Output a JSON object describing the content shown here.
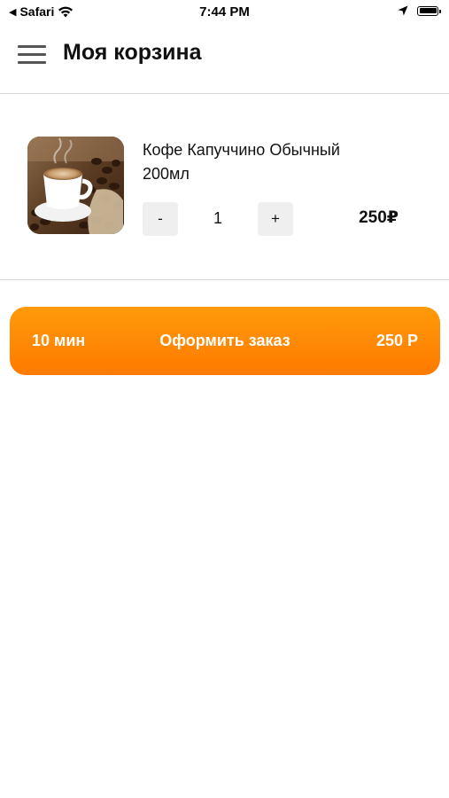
{
  "status_bar": {
    "back_app": "Safari",
    "time": "7:44 PM"
  },
  "header": {
    "title": "Моя корзина"
  },
  "cart": {
    "items": [
      {
        "name": "Кофе Капуччино Обычный 200мл",
        "quantity": "1",
        "minus_label": "-",
        "plus_label": "+",
        "price": "250₽",
        "image_icon": "coffee-cup-photo"
      }
    ]
  },
  "checkout": {
    "time": "10 мин",
    "label": "Оформить заказ",
    "total": "250 Р"
  },
  "colors": {
    "accent_top": "#ff9a0a",
    "accent_bottom": "#ff7a00",
    "divider": "#d6d6d6",
    "qty_button_bg": "#efefef"
  }
}
